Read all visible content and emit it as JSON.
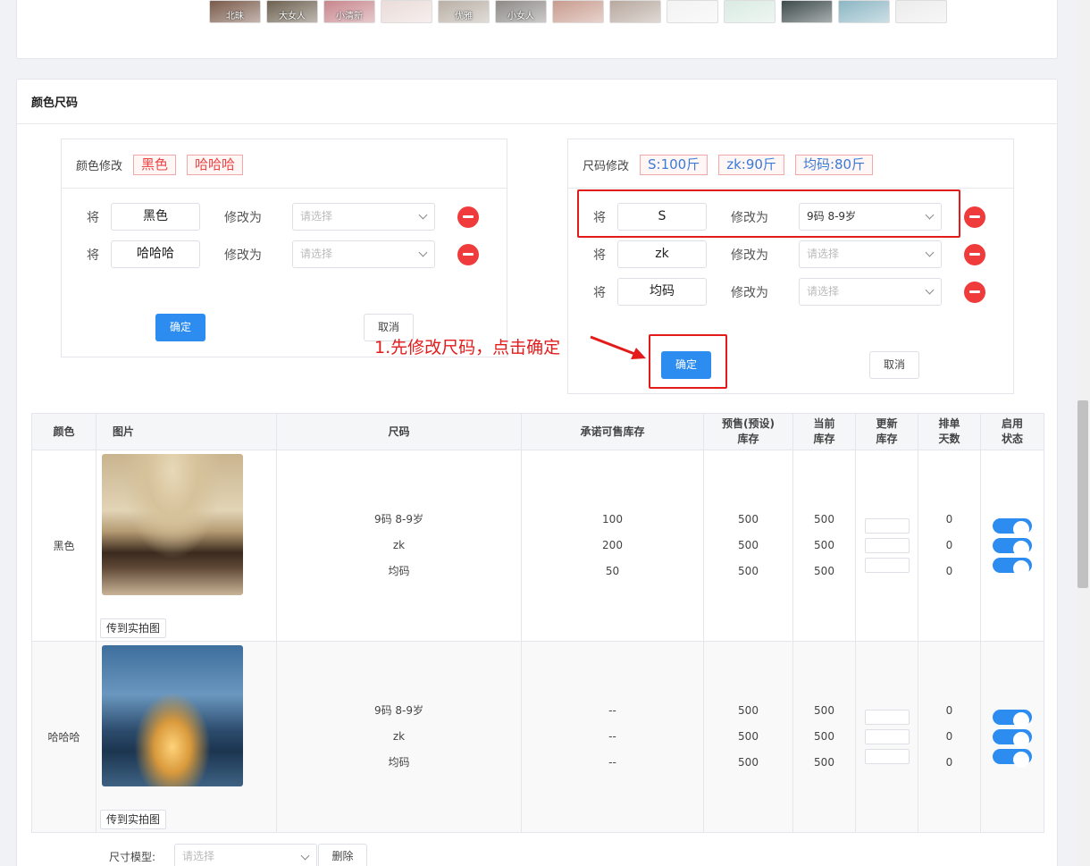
{
  "top_thumbs": [
    {
      "label": "北昧",
      "color": "#7a5a4a"
    },
    {
      "label": "大女人",
      "color": "#6d6150"
    },
    {
      "label": "小清新",
      "color": "#c7868d"
    },
    {
      "label": "",
      "color": "#eadbd8"
    },
    {
      "label": "优雅",
      "color": "#b9b0a6"
    },
    {
      "label": "小女人",
      "color": "#8d8a86"
    },
    {
      "label": "",
      "color": "#c89b8e"
    },
    {
      "label": "",
      "color": "#b7a89e"
    },
    {
      "label": "",
      "color": "#f3f3f3"
    },
    {
      "label": "",
      "color": "#d9ebe3"
    },
    {
      "label": "",
      "color": "#3d4a4b"
    },
    {
      "label": "",
      "color": "#8cb6c4"
    },
    {
      "label": "",
      "color": "#ececec"
    }
  ],
  "section_title": "颜色尺码",
  "color_panel": {
    "label": "颜色修改",
    "tags": [
      "黑色",
      "哈哈哈"
    ],
    "rows": [
      {
        "prefix": "将",
        "value": "黑色",
        "modify_label": "修改为",
        "select": "请选择"
      },
      {
        "prefix": "将",
        "value": "哈哈哈",
        "modify_label": "修改为",
        "select": "请选择"
      }
    ],
    "confirm": "确定",
    "cancel": "取消"
  },
  "size_panel": {
    "label": "尺码修改",
    "tags": [
      "S:100斤",
      "zk:90斤",
      "均码:80斤"
    ],
    "rows": [
      {
        "prefix": "将",
        "value": "S",
        "modify_label": "修改为",
        "select": "9码 8-9岁"
      },
      {
        "prefix": "将",
        "value": "zk",
        "modify_label": "修改为",
        "select": "请选择"
      },
      {
        "prefix": "将",
        "value": "均码",
        "modify_label": "修改为",
        "select": "请选择"
      }
    ],
    "confirm": "确定",
    "cancel": "取消"
  },
  "annotation": "1.先修改尺码，点击确定",
  "table": {
    "headers": {
      "color": "颜色",
      "image": "图片",
      "size": "尺码",
      "promise": "承诺可售库存",
      "presale_1": "预售(预设)",
      "presale_2": "库存",
      "current_1": "当前",
      "current_2": "库存",
      "update_1": "更新",
      "update_2": "库存",
      "days_1": "排单",
      "days_2": "天数",
      "status_1": "启用",
      "status_2": "状态"
    },
    "rows": [
      {
        "color": "黑色",
        "upload": "传到实拍图",
        "sizes": [
          "9码 8-9岁",
          "zk",
          "均码"
        ],
        "promise": [
          "100",
          "200",
          "50"
        ],
        "presale": [
          "500",
          "500",
          "500"
        ],
        "current": [
          "500",
          "500",
          "500"
        ],
        "days": [
          "0",
          "0",
          "0"
        ]
      },
      {
        "color": "哈哈哈",
        "upload": "传到实拍图",
        "sizes": [
          "9码 8-9岁",
          "zk",
          "均码"
        ],
        "promise": [
          "--",
          "--",
          "--"
        ],
        "presale": [
          "500",
          "500",
          "500"
        ],
        "current": [
          "500",
          "500",
          "500"
        ],
        "days": [
          "0",
          "0",
          "0"
        ]
      }
    ]
  },
  "size_model": {
    "label": "尺寸模型:",
    "placeholder": "请选择",
    "delete": "删除"
  }
}
